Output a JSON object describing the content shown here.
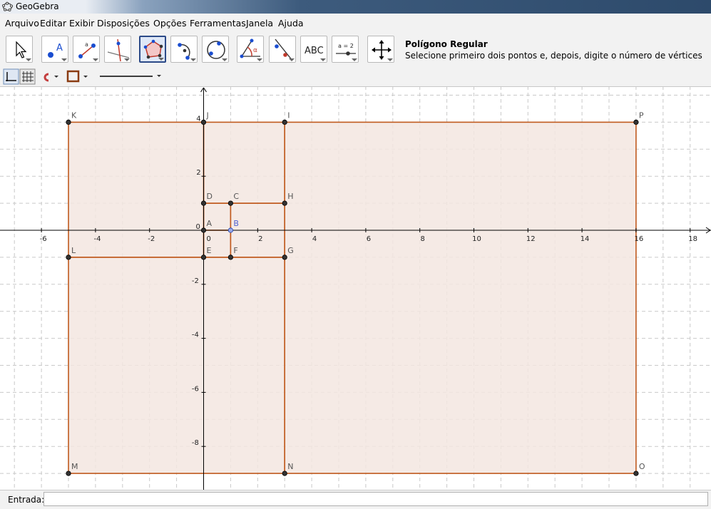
{
  "window": {
    "title": "GeoGebra"
  },
  "menu": [
    "Arquivo",
    "Editar",
    "Exibir",
    "Disposições",
    "Opções",
    "Ferramentas",
    "Janela",
    "Ajuda"
  ],
  "toolbar": {
    "active_tool": "regular-polygon",
    "tools": [
      "move",
      "point",
      "segment",
      "perpendicular-line",
      "regular-polygon",
      "semicircle",
      "circle",
      "angle",
      "reflect",
      "text",
      "slider",
      "move-graphics-view"
    ],
    "text_tool_label": "ABC",
    "slider_tool_label": "a = 2",
    "help_title": "Polígono Regular",
    "help_text": "Selecione primeiro dois pontos e, depois, digite o número de vértices"
  },
  "style": {
    "polygon_stroke": "#c05a1e",
    "polygon_fill": "#f3e6e0",
    "point_color": "#333333",
    "selected_point_color": "#9aa9e6",
    "label_color": "#555555",
    "selected_label_color": "#5060d0"
  },
  "graphics": {
    "x_ticks": [
      "-6",
      "-4",
      "-2",
      "0",
      "2",
      "4",
      "6",
      "8",
      "10",
      "12",
      "14",
      "16",
      "18"
    ],
    "y_ticks": [
      "4",
      "2",
      "0",
      "-2",
      "-4",
      "-6",
      "-8"
    ],
    "points": [
      {
        "label": "A",
        "x": 0,
        "y": 0
      },
      {
        "label": "B",
        "x": 1,
        "y": 0,
        "selected": true
      },
      {
        "label": "C",
        "x": 1,
        "y": 1
      },
      {
        "label": "D",
        "x": 0,
        "y": 1
      },
      {
        "label": "E",
        "x": 0,
        "y": -1
      },
      {
        "label": "F",
        "x": 1,
        "y": -1
      },
      {
        "label": "G",
        "x": 3,
        "y": -1
      },
      {
        "label": "H",
        "x": 3,
        "y": 1
      },
      {
        "label": "I",
        "x": 3,
        "y": 4
      },
      {
        "label": "J",
        "x": 0,
        "y": 4
      },
      {
        "label": "K",
        "x": -5,
        "y": 4
      },
      {
        "label": "L",
        "x": -5,
        "y": -1
      },
      {
        "label": "M",
        "x": -5,
        "y": -9
      },
      {
        "label": "N",
        "x": 3,
        "y": -9
      },
      {
        "label": "O",
        "x": 16,
        "y": -9
      },
      {
        "label": "P",
        "x": 16,
        "y": 4
      }
    ],
    "polygons": [
      [
        "A",
        "B",
        "C",
        "D"
      ],
      [
        "E",
        "F",
        "B",
        "A"
      ],
      [
        "F",
        "G",
        "H",
        "C"
      ],
      [
        "D",
        "H",
        "I",
        "J"
      ],
      [
        "L",
        "E",
        "J",
        "K"
      ],
      [
        "M",
        "N",
        "G",
        "L"
      ],
      [
        "N",
        "O",
        "P",
        "I"
      ]
    ]
  },
  "input_bar": {
    "label": "Entrada:",
    "value": ""
  }
}
